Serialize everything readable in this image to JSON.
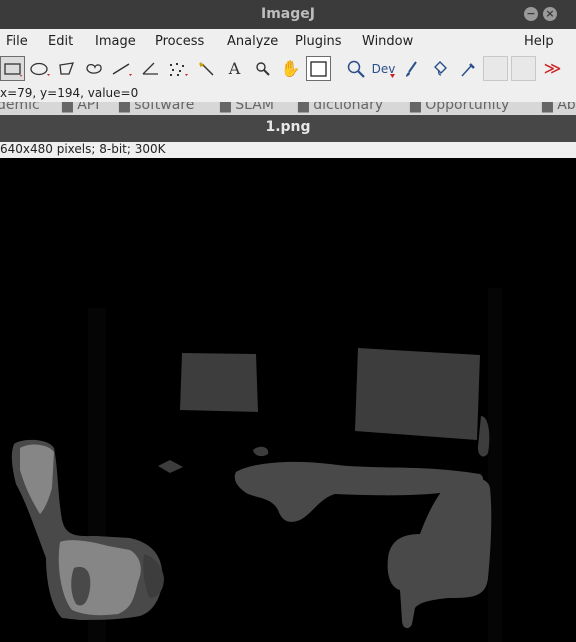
{
  "app": {
    "title": "ImageJ"
  },
  "window_buttons": {
    "minimize": "−",
    "close": "×"
  },
  "menu": [
    "File",
    "Edit",
    "Image",
    "Process",
    "Analyze",
    "Plugins",
    "Window",
    "Help"
  ],
  "toolbar": {
    "dev_label": "Dev",
    "overflow_glyph": "≫",
    "tools": [
      "rectangle-icon",
      "oval-icon",
      "polygon-icon",
      "freehand-icon",
      "line-icon",
      "angle-icon",
      "multipoint-icon",
      "wand-icon",
      "text-icon",
      "zoom-icon",
      "hand-icon",
      "dropper-icon",
      "magnifier-icon",
      "dev-menu",
      "brush-icon",
      "flood-fill-icon",
      "pipette-icon"
    ],
    "accent_red": "#cc2222"
  },
  "status": {
    "text": "x=79, y=194, value=0"
  },
  "bookmarks": [
    "demic",
    "API",
    "software",
    "SLAM",
    "dictionary",
    "Opportunity",
    "Ab"
  ],
  "image_window": {
    "title": "1.png",
    "info": "640x480 pixels; 8-bit; 300K"
  },
  "colors": {
    "title_bg": "#3b3b3b",
    "menu_bg": "#efefef",
    "segment_dark": "#3d3d3d",
    "segment_mid": "#494949",
    "segment_light": "#868686"
  }
}
